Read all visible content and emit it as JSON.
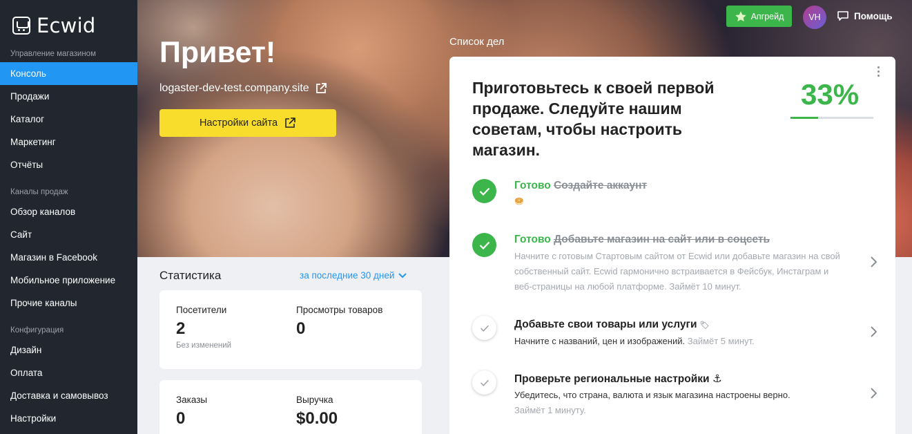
{
  "sidebar": {
    "logo_text": "Ecwid",
    "sections": [
      {
        "title": "Управление магазином",
        "items": [
          "Консоль",
          "Продажи",
          "Каталог",
          "Маркетинг",
          "Отчёты"
        ]
      },
      {
        "title": "Каналы продаж",
        "items": [
          "Обзор каналов",
          "Сайт",
          "Магазин в Facebook",
          "Мобильное приложение",
          "Прочие каналы"
        ]
      },
      {
        "title": "Конфигурация",
        "items": [
          "Дизайн",
          "Оплата",
          "Доставка и самовывоз",
          "Настройки"
        ]
      }
    ],
    "active_item": "Консоль"
  },
  "topbar": {
    "upgrade_label": "Апгрейд",
    "avatar_initials": "VH",
    "help_label": "Помощь"
  },
  "hero": {
    "greeting": "Привет!",
    "store_url": "logaster-dev-test.company.site",
    "settings_button": "Настройки сайта"
  },
  "stats": {
    "title": "Статистика",
    "period": "за последние 30 дней",
    "cards": [
      [
        {
          "label": "Посетители",
          "value": "2",
          "note": "Без изменений"
        },
        {
          "label": "Просмотры товаров",
          "value": "0",
          "note": ""
        }
      ],
      [
        {
          "label": "Заказы",
          "value": "0",
          "note": ""
        },
        {
          "label": "Выручка",
          "value": "$0.00",
          "note": ""
        }
      ]
    ]
  },
  "todo": {
    "header": "Список дел",
    "title": "Приготовьтесь к своей первой продаже. Следуйте нашим советам, чтобы настроить магазин.",
    "percent": "33%",
    "progress": 0.33,
    "tasks": [
      {
        "done_word": "Готово",
        "title": "Создайте аккаунт",
        "desc": "",
        "icon": "🥯"
      },
      {
        "done_word": "Готово",
        "title": "Добавьте магазин на сайт или в соцсеть",
        "desc": "Начните с готовым Стартовым сайтом от Ecwid или добавьте магазин на свой собственный сайт. Ecwid гармонично встраивается в Фейсбук, Инстаграм и веб-страницы на любой платформе. Займёт 10 минут.",
        "icon": ""
      },
      {
        "done_word": "",
        "title": "Добавьте свои товары или услуги",
        "icon": "🏷",
        "desc": "Начните с названий, цен и изображений.",
        "time": "Займёт 5 минут."
      },
      {
        "done_word": "",
        "title": "Проверьте региональные настройки",
        "icon": "⚓",
        "desc": "Убедитесь, что страна, валюта и язык магазина настроены верно.",
        "time": "Займёт 1 минуту."
      }
    ]
  },
  "colors": {
    "sidebar_bg": "#22272f",
    "accent_blue": "#2196f3",
    "green": "#3cb64b",
    "yellow": "#f8dd2c"
  }
}
